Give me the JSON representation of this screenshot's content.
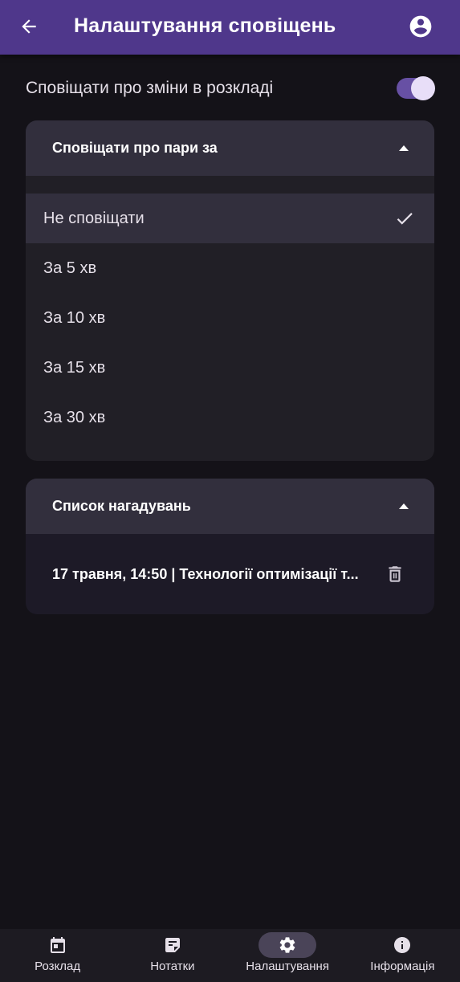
{
  "topbar": {
    "title": "Налаштування сповіщень",
    "back_icon": "arrow-back-icon",
    "account_icon": "account-circle-icon",
    "color": "#4f378b"
  },
  "schedule_changes": {
    "label": "Сповіщати про зміни в розкладі",
    "enabled": true
  },
  "lesson_notify": {
    "header": "Сповіщати про пари за",
    "expanded": true,
    "options": [
      {
        "label": "Не сповіщати",
        "selected": true
      },
      {
        "label": "За 5 хв",
        "selected": false
      },
      {
        "label": "За 10 хв",
        "selected": false
      },
      {
        "label": "За 15 хв",
        "selected": false
      },
      {
        "label": "За 30 хв",
        "selected": false
      }
    ]
  },
  "reminders": {
    "header": "Список нагадувань",
    "expanded": true,
    "items": [
      {
        "text": "17 травня, 14:50 | Технології оптимізації т..."
      }
    ]
  },
  "bottom_nav": {
    "items": [
      {
        "label": "Розклад",
        "icon": "calendar-icon",
        "active": false
      },
      {
        "label": "Нотатки",
        "icon": "notes-icon",
        "active": false
      },
      {
        "label": "Налаштування",
        "icon": "gear-icon",
        "active": true
      },
      {
        "label": "Інформація",
        "icon": "info-icon",
        "active": false
      }
    ]
  },
  "colors": {
    "background": "#141218",
    "accent": "#6750a4",
    "card": "#211f26",
    "header": "#322f3d"
  }
}
